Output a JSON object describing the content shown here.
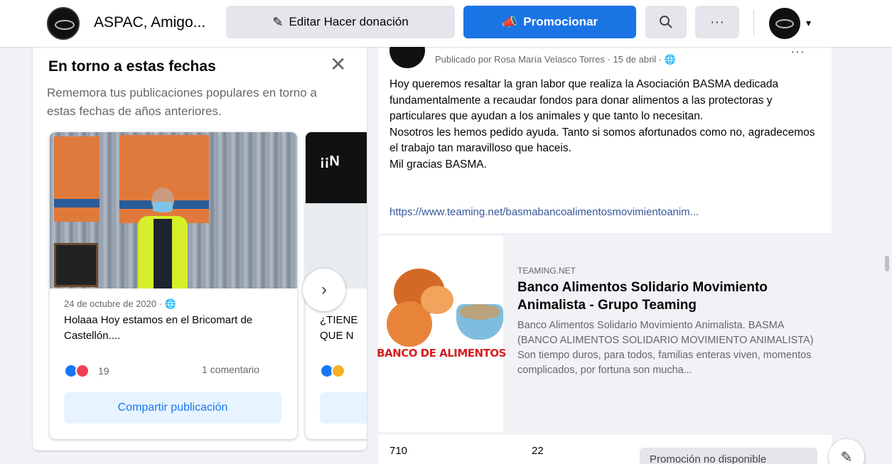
{
  "header": {
    "page_name": "ASPAC, Amigo...",
    "edit_label": "Editar Hacer donación",
    "promote_label": "Promocionar",
    "search_icon": "search-icon",
    "more_label": "···",
    "caret": "▾"
  },
  "memories": {
    "title": "En torno a estas fechas",
    "close": "✕",
    "subtitle": "Rememora tus publicaciones populares en torno a estas fechas de años anteriores.",
    "items": [
      {
        "photo_banner": "",
        "date": "24 de octubre de 2020 · 🌐",
        "text": "Holaaa Hoy estamos en el Bricomart de Castellón....",
        "reaction_count": "19",
        "comments": "1 comentario",
        "share_label": "Compartir publicación"
      },
      {
        "photo_banner": "¡¡N",
        "date": "",
        "text": "¿TIENE\nQUE N",
        "reaction_count": "",
        "comments": "",
        "share_label": ""
      }
    ],
    "next_label": "›"
  },
  "post": {
    "meta": "Publicado por Rosa María Velasco Torres · 15 de abril · 🌐",
    "more": "···",
    "text": "Hoy queremos resaltar la gran labor que realiza la Asociación BASMA dedicada fundamentalmente a recaudar fondos para donar alimentos a las protectoras y particulares que ayudan a los animales y que tanto lo necesitan.\nNosotros les hemos pedido ayuda. Tanto si somos afortunados como no, agradecemos el trabajo tan maravilloso que haceis.\nMil gracias BASMA.",
    "link": "https://www.teaming.net/basmabancoalimentosmovimientoanim..."
  },
  "link_preview": {
    "image_text": "BANCO DE ALIMENTOS",
    "domain": "TEAMING.NET",
    "title": "Banco Alimentos Solidario Movimiento Animalista - Grupo Teaming",
    "description": "Banco Alimentos Solidario Movimiento Animalista. BASMA (BANCO ALIMENTOS SOLIDARIO MOVIMIENTO ANIMALISTA) Son tiempo duros, para todos, familias enteras viven, momentos complicados, por fortuna son mucha..."
  },
  "stats": {
    "reached": "710",
    "engagements": "22",
    "promo_unavailable": "Promoción no disponible"
  },
  "compose_icon": "✎",
  "colors": {
    "brand": "#1b74e4",
    "link": "#385898",
    "background": "#f0f2f5"
  }
}
